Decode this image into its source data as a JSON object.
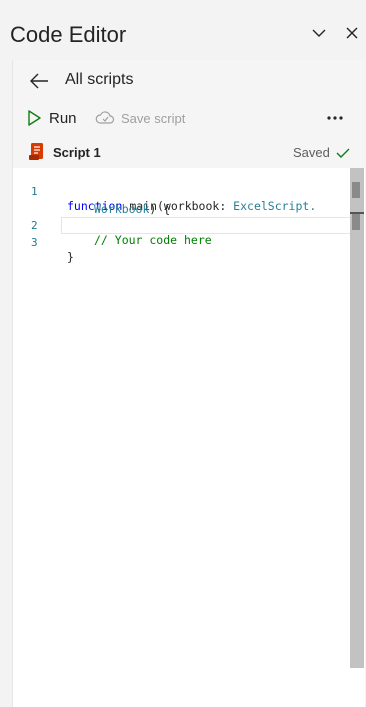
{
  "pane": {
    "title": "Code Editor"
  },
  "nav": {
    "back_label": "All scripts"
  },
  "toolbar": {
    "run_label": "Run",
    "save_label": "Save script"
  },
  "script": {
    "name": "Script 1",
    "status": "Saved"
  },
  "editor": {
    "line_numbers": [
      "1",
      "2",
      "3"
    ],
    "line1_keyword": "function",
    "line1_text": " main(workbook: ",
    "line1_type": "ExcelScript.",
    "line1_cont_type": "Workbook",
    "line1_cont_text": ") {",
    "line2_comment": "// Your code here",
    "line3_text": "}"
  },
  "colors": {
    "run_icon": "#107c10",
    "saved_check": "#107c10",
    "script_icon": "#d83b01",
    "line_number": "#237893",
    "keyword": "#0000ff",
    "type": "#267f99",
    "comment": "#008000"
  },
  "icons": {
    "collapse": "chevron-down-icon",
    "close": "close-icon",
    "back": "arrow-left-icon",
    "run": "play-icon",
    "save": "cloud-save-icon",
    "more": "more-dots-icon",
    "script": "script-file-icon",
    "saved": "checkmark-icon"
  }
}
